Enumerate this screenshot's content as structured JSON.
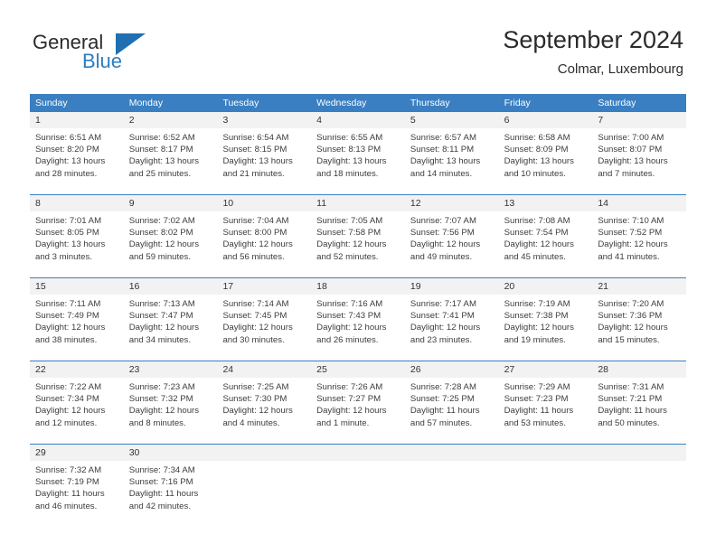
{
  "brand": {
    "name_part1": "General",
    "name_part2": "Blue",
    "logo_icon": "triangle-logo-icon"
  },
  "header": {
    "title": "September 2024",
    "subtitle": "Colmar, Luxembourg"
  },
  "colors": {
    "header_blue": "#3a7fc1",
    "brand_blue": "#2c7ec1",
    "daynum_bg": "#f2f2f2",
    "text": "#3d3d3d"
  },
  "calendar": {
    "weekday_headers": [
      "Sunday",
      "Monday",
      "Tuesday",
      "Wednesday",
      "Thursday",
      "Friday",
      "Saturday"
    ],
    "weeks": [
      [
        {
          "day": "1",
          "sunrise": "Sunrise: 6:51 AM",
          "sunset": "Sunset: 8:20 PM",
          "daylight1": "Daylight: 13 hours",
          "daylight2": "and 28 minutes."
        },
        {
          "day": "2",
          "sunrise": "Sunrise: 6:52 AM",
          "sunset": "Sunset: 8:17 PM",
          "daylight1": "Daylight: 13 hours",
          "daylight2": "and 25 minutes."
        },
        {
          "day": "3",
          "sunrise": "Sunrise: 6:54 AM",
          "sunset": "Sunset: 8:15 PM",
          "daylight1": "Daylight: 13 hours",
          "daylight2": "and 21 minutes."
        },
        {
          "day": "4",
          "sunrise": "Sunrise: 6:55 AM",
          "sunset": "Sunset: 8:13 PM",
          "daylight1": "Daylight: 13 hours",
          "daylight2": "and 18 minutes."
        },
        {
          "day": "5",
          "sunrise": "Sunrise: 6:57 AM",
          "sunset": "Sunset: 8:11 PM",
          "daylight1": "Daylight: 13 hours",
          "daylight2": "and 14 minutes."
        },
        {
          "day": "6",
          "sunrise": "Sunrise: 6:58 AM",
          "sunset": "Sunset: 8:09 PM",
          "daylight1": "Daylight: 13 hours",
          "daylight2": "and 10 minutes."
        },
        {
          "day": "7",
          "sunrise": "Sunrise: 7:00 AM",
          "sunset": "Sunset: 8:07 PM",
          "daylight1": "Daylight: 13 hours",
          "daylight2": "and 7 minutes."
        }
      ],
      [
        {
          "day": "8",
          "sunrise": "Sunrise: 7:01 AM",
          "sunset": "Sunset: 8:05 PM",
          "daylight1": "Daylight: 13 hours",
          "daylight2": "and 3 minutes."
        },
        {
          "day": "9",
          "sunrise": "Sunrise: 7:02 AM",
          "sunset": "Sunset: 8:02 PM",
          "daylight1": "Daylight: 12 hours",
          "daylight2": "and 59 minutes."
        },
        {
          "day": "10",
          "sunrise": "Sunrise: 7:04 AM",
          "sunset": "Sunset: 8:00 PM",
          "daylight1": "Daylight: 12 hours",
          "daylight2": "and 56 minutes."
        },
        {
          "day": "11",
          "sunrise": "Sunrise: 7:05 AM",
          "sunset": "Sunset: 7:58 PM",
          "daylight1": "Daylight: 12 hours",
          "daylight2": "and 52 minutes."
        },
        {
          "day": "12",
          "sunrise": "Sunrise: 7:07 AM",
          "sunset": "Sunset: 7:56 PM",
          "daylight1": "Daylight: 12 hours",
          "daylight2": "and 49 minutes."
        },
        {
          "day": "13",
          "sunrise": "Sunrise: 7:08 AM",
          "sunset": "Sunset: 7:54 PM",
          "daylight1": "Daylight: 12 hours",
          "daylight2": "and 45 minutes."
        },
        {
          "day": "14",
          "sunrise": "Sunrise: 7:10 AM",
          "sunset": "Sunset: 7:52 PM",
          "daylight1": "Daylight: 12 hours",
          "daylight2": "and 41 minutes."
        }
      ],
      [
        {
          "day": "15",
          "sunrise": "Sunrise: 7:11 AM",
          "sunset": "Sunset: 7:49 PM",
          "daylight1": "Daylight: 12 hours",
          "daylight2": "and 38 minutes."
        },
        {
          "day": "16",
          "sunrise": "Sunrise: 7:13 AM",
          "sunset": "Sunset: 7:47 PM",
          "daylight1": "Daylight: 12 hours",
          "daylight2": "and 34 minutes."
        },
        {
          "day": "17",
          "sunrise": "Sunrise: 7:14 AM",
          "sunset": "Sunset: 7:45 PM",
          "daylight1": "Daylight: 12 hours",
          "daylight2": "and 30 minutes."
        },
        {
          "day": "18",
          "sunrise": "Sunrise: 7:16 AM",
          "sunset": "Sunset: 7:43 PM",
          "daylight1": "Daylight: 12 hours",
          "daylight2": "and 26 minutes."
        },
        {
          "day": "19",
          "sunrise": "Sunrise: 7:17 AM",
          "sunset": "Sunset: 7:41 PM",
          "daylight1": "Daylight: 12 hours",
          "daylight2": "and 23 minutes."
        },
        {
          "day": "20",
          "sunrise": "Sunrise: 7:19 AM",
          "sunset": "Sunset: 7:38 PM",
          "daylight1": "Daylight: 12 hours",
          "daylight2": "and 19 minutes."
        },
        {
          "day": "21",
          "sunrise": "Sunrise: 7:20 AM",
          "sunset": "Sunset: 7:36 PM",
          "daylight1": "Daylight: 12 hours",
          "daylight2": "and 15 minutes."
        }
      ],
      [
        {
          "day": "22",
          "sunrise": "Sunrise: 7:22 AM",
          "sunset": "Sunset: 7:34 PM",
          "daylight1": "Daylight: 12 hours",
          "daylight2": "and 12 minutes."
        },
        {
          "day": "23",
          "sunrise": "Sunrise: 7:23 AM",
          "sunset": "Sunset: 7:32 PM",
          "daylight1": "Daylight: 12 hours",
          "daylight2": "and 8 minutes."
        },
        {
          "day": "24",
          "sunrise": "Sunrise: 7:25 AM",
          "sunset": "Sunset: 7:30 PM",
          "daylight1": "Daylight: 12 hours",
          "daylight2": "and 4 minutes."
        },
        {
          "day": "25",
          "sunrise": "Sunrise: 7:26 AM",
          "sunset": "Sunset: 7:27 PM",
          "daylight1": "Daylight: 12 hours",
          "daylight2": "and 1 minute."
        },
        {
          "day": "26",
          "sunrise": "Sunrise: 7:28 AM",
          "sunset": "Sunset: 7:25 PM",
          "daylight1": "Daylight: 11 hours",
          "daylight2": "and 57 minutes."
        },
        {
          "day": "27",
          "sunrise": "Sunrise: 7:29 AM",
          "sunset": "Sunset: 7:23 PM",
          "daylight1": "Daylight: 11 hours",
          "daylight2": "and 53 minutes."
        },
        {
          "day": "28",
          "sunrise": "Sunrise: 7:31 AM",
          "sunset": "Sunset: 7:21 PM",
          "daylight1": "Daylight: 11 hours",
          "daylight2": "and 50 minutes."
        }
      ],
      [
        {
          "day": "29",
          "sunrise": "Sunrise: 7:32 AM",
          "sunset": "Sunset: 7:19 PM",
          "daylight1": "Daylight: 11 hours",
          "daylight2": "and 46 minutes."
        },
        {
          "day": "30",
          "sunrise": "Sunrise: 7:34 AM",
          "sunset": "Sunset: 7:16 PM",
          "daylight1": "Daylight: 11 hours",
          "daylight2": "and 42 minutes."
        },
        {
          "day": "",
          "sunrise": "",
          "sunset": "",
          "daylight1": "",
          "daylight2": ""
        },
        {
          "day": "",
          "sunrise": "",
          "sunset": "",
          "daylight1": "",
          "daylight2": ""
        },
        {
          "day": "",
          "sunrise": "",
          "sunset": "",
          "daylight1": "",
          "daylight2": ""
        },
        {
          "day": "",
          "sunrise": "",
          "sunset": "",
          "daylight1": "",
          "daylight2": ""
        },
        {
          "day": "",
          "sunrise": "",
          "sunset": "",
          "daylight1": "",
          "daylight2": ""
        }
      ]
    ]
  }
}
